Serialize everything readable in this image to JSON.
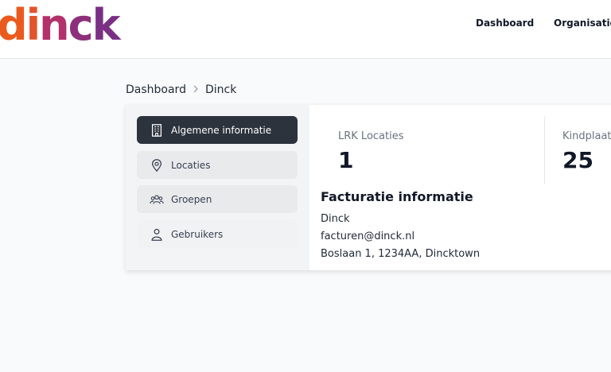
{
  "brand": {
    "logo_letters": [
      "d",
      "i",
      "n",
      "c",
      "k"
    ]
  },
  "nav": {
    "items": [
      "Dashboard",
      "Organisatie"
    ]
  },
  "breadcrumb": {
    "root": "Dashboard",
    "current": "Dinck"
  },
  "sidebar": {
    "items": [
      {
        "label": "Algemene informatie",
        "icon": "building-icon",
        "active": true
      },
      {
        "label": "Locaties",
        "icon": "map-pin-icon",
        "active": false
      },
      {
        "label": "Groepen",
        "icon": "users-group-icon",
        "active": false
      },
      {
        "label": "Gebruikers",
        "icon": "user-icon",
        "active": false
      }
    ]
  },
  "stats": [
    {
      "label": "LRK Locaties",
      "value": "1"
    },
    {
      "label": "Kindplaat",
      "value": "25"
    }
  ],
  "billing": {
    "title": "Facturatie informatie",
    "name": "Dinck",
    "email": "facturen@dinck.nl",
    "address": "Boslaan 1, 1234AA, Dincktown"
  },
  "colors": {
    "active_bg": "#2d333d",
    "logo_orange": "#ea5a1e",
    "logo_purple": "#7a2f84"
  }
}
